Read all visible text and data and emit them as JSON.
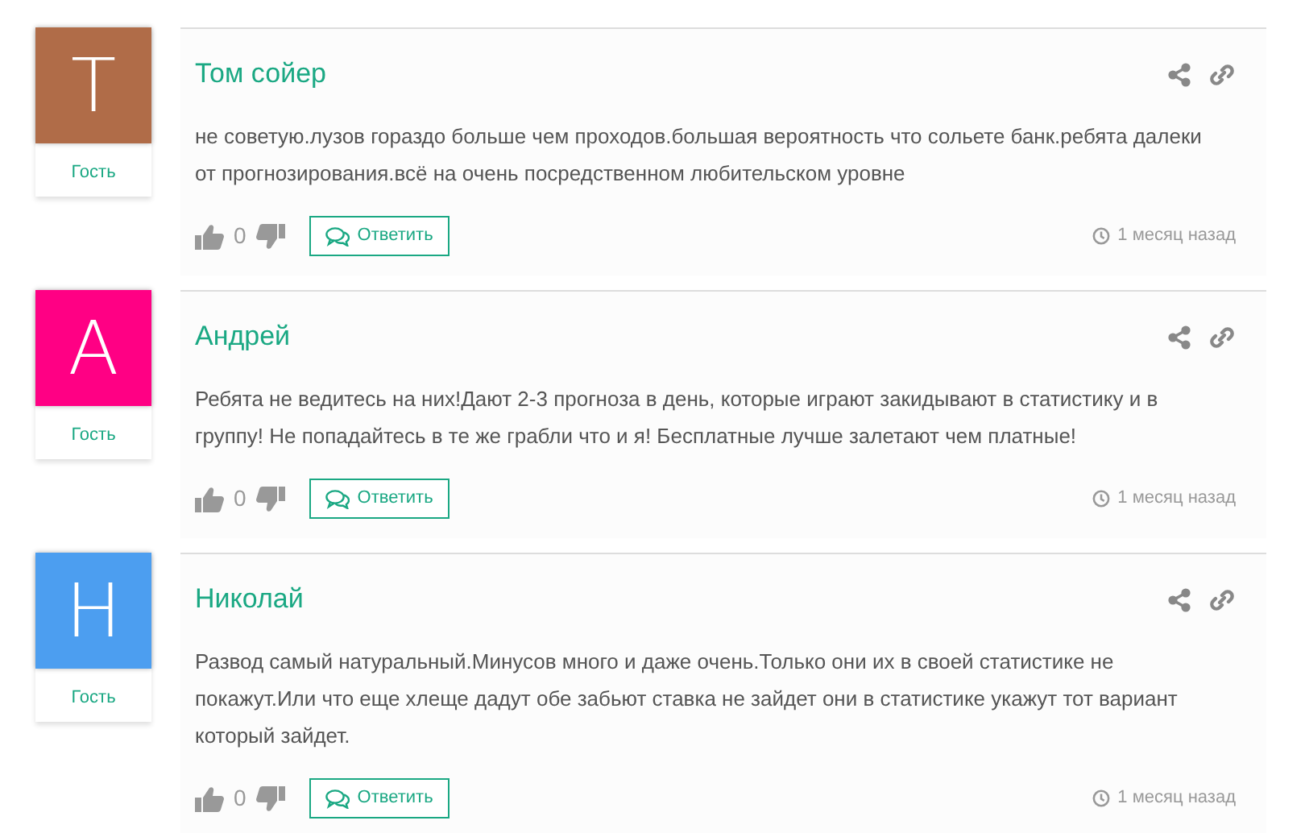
{
  "comments": [
    {
      "initial": "T",
      "color": "#b06c48",
      "author": "Том сойер",
      "role": "Гость",
      "text": "не советую.лузов гораздо больше чем проходов.большая вероятность что сольете банк.ребята далеки от прогнозирования.всё на очень посредственном любительском уровне",
      "votes": "0",
      "reply": "Ответить",
      "time": "1 месяц назад"
    },
    {
      "initial": "A",
      "color": "#ff0084",
      "author": "Андрей",
      "role": "Гость",
      "text": "Ребята не ведитесь на них!Дают 2-3 прогноза в день, которые играют закидывают в статистику и в группу! Не попадайтесь в те же грабли что и я! Бесплатные лучше залетают чем платные!",
      "votes": "0",
      "reply": "Ответить",
      "time": "1 месяц назад"
    },
    {
      "initial": "H",
      "color": "#4c9ef0",
      "author": "Николай",
      "role": "Гость",
      "text": "Развод самый натуральный.Минусов много и даже очень.Только они их в своей статистике не покажут.Или что еще хлеще дадут обе забьют ставка не зайдет они в статистике укажут тот вариант который зайдет.",
      "votes": "0",
      "reply": "Ответить",
      "time": "1 месяц назад"
    }
  ]
}
